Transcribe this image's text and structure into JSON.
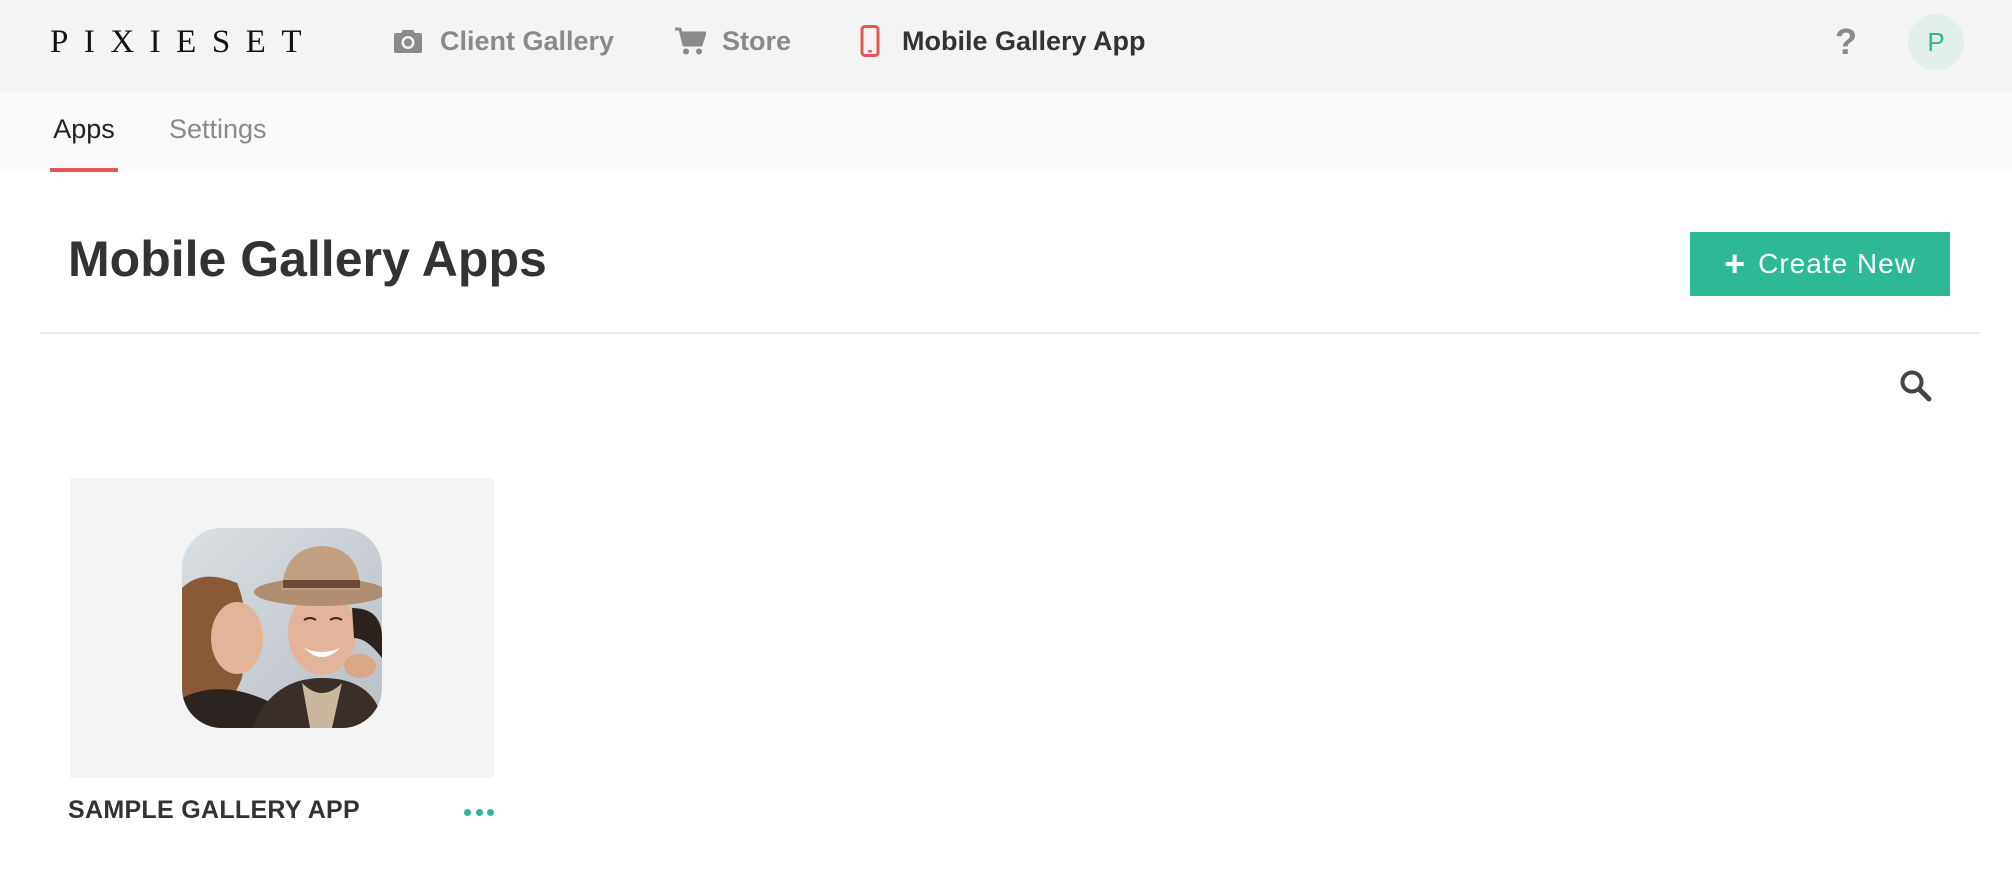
{
  "brand": {
    "logo_text": "PIXIESET",
    "accent_color": "#2db996",
    "active_tab_color": "#e35656"
  },
  "topnav": {
    "items": [
      {
        "label": "Client Gallery",
        "icon": "camera-icon",
        "active": false
      },
      {
        "label": "Store",
        "icon": "cart-icon",
        "active": false
      },
      {
        "label": "Mobile Gallery App",
        "icon": "mobile-phone-icon",
        "active": true
      }
    ],
    "help_label": "?",
    "avatar_initial": "P"
  },
  "subtabs": {
    "items": [
      {
        "label": "Apps",
        "active": true
      },
      {
        "label": "Settings",
        "active": false
      }
    ]
  },
  "main": {
    "title": "Mobile Gallery Apps",
    "create_button_label": "Create New",
    "search_icon": "search-icon"
  },
  "apps": [
    {
      "name": "SAMPLE GALLERY APP",
      "menu_icon": "more-horizontal-icon"
    }
  ]
}
